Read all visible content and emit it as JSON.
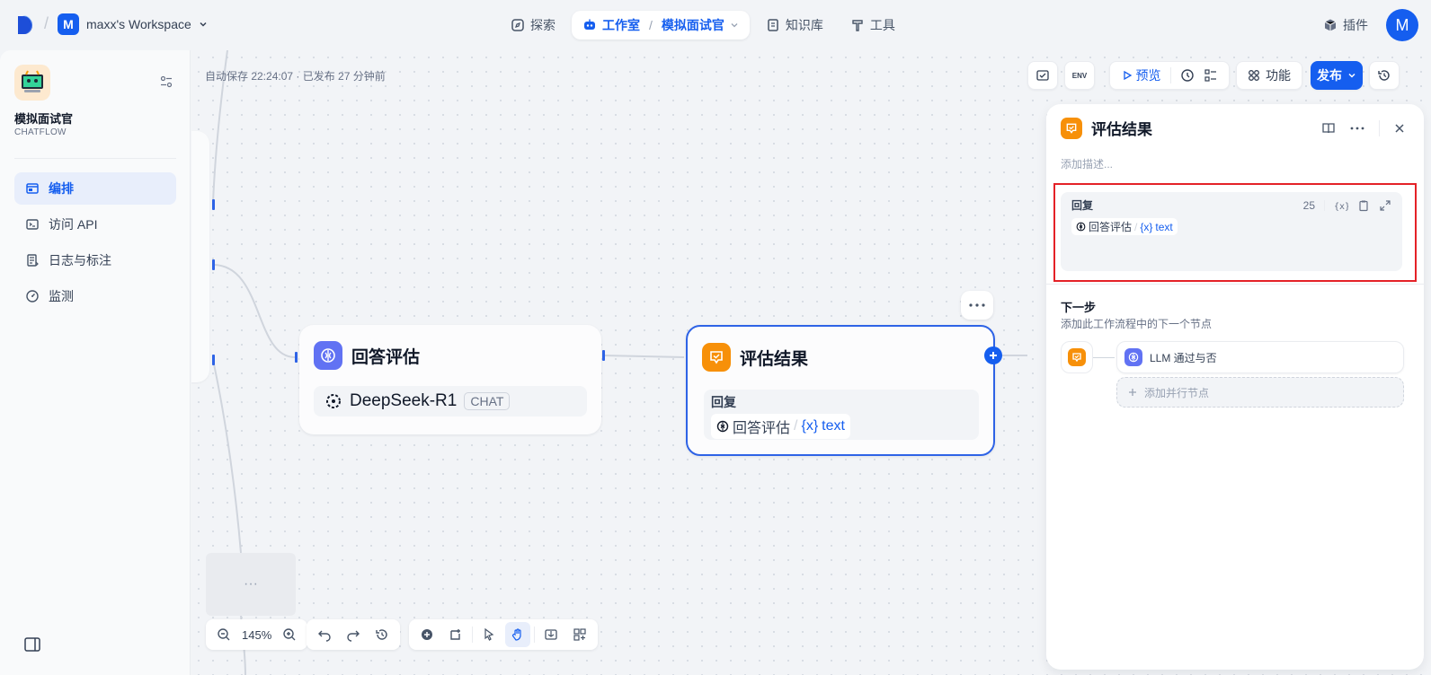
{
  "topbar": {
    "workspace_initial": "M",
    "workspace_name": "maxx's Workspace",
    "nav": [
      {
        "label": "探索"
      },
      {
        "label": "工作室",
        "sub": "模拟面试官"
      },
      {
        "label": "知识库"
      },
      {
        "label": "工具"
      }
    ],
    "plugins_label": "插件",
    "user_initial": "M"
  },
  "sidebar": {
    "app_name": "模拟面试官",
    "app_type": "CHATFLOW",
    "items": [
      {
        "label": "编排"
      },
      {
        "label": "访问 API"
      },
      {
        "label": "日志与标注"
      },
      {
        "label": "监测"
      }
    ]
  },
  "canvas": {
    "autosave": "自动保存 22:24:07 · 已发布 27 分钟前",
    "toolbar": {
      "preview_label": "预览",
      "features_label": "功能",
      "publish_label": "发布",
      "env_label": "ENV"
    },
    "zoom": "145%",
    "llm_node": {
      "title": "回答评估",
      "model": "DeepSeek-R1",
      "model_tag": "CHAT"
    },
    "answer_node": {
      "title": "评估结果",
      "field_label": "回复",
      "var_source": "回答评估",
      "var_sep": "/",
      "var_prefix": "{x}",
      "var_name": "text"
    },
    "ghost_label": "···"
  },
  "panel": {
    "title": "评估结果",
    "desc_placeholder": "添加描述...",
    "answer": {
      "label": "回复",
      "count": "25",
      "var_source": "回答评估",
      "var_sep": "/",
      "var_prefix": "{x}",
      "var_name": "text"
    },
    "next": {
      "title": "下一步",
      "subtitle": "添加此工作流程中的下一个节点",
      "node_label": "LLM 通过与否",
      "add_parallel": "添加并行节点"
    }
  },
  "colors": {
    "accent": "#155eef",
    "llm_node": "#6172f3",
    "answer_node": "#f79009",
    "highlight": "#e42127"
  }
}
